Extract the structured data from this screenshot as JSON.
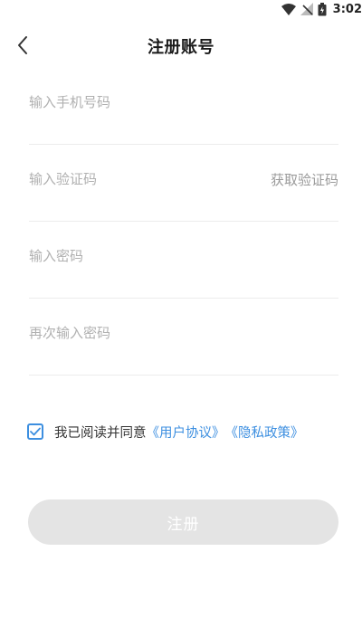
{
  "status_bar": {
    "time": "3:02",
    "icons": [
      "wifi-icon",
      "signal-icon",
      "battery-icon"
    ]
  },
  "header": {
    "back_icon": "chevron-left-icon",
    "title": "注册账号"
  },
  "form": {
    "phone": {
      "placeholder": "输入手机号码",
      "value": ""
    },
    "code": {
      "placeholder": "输入验证码",
      "value": "",
      "action_label": "获取验证码"
    },
    "password": {
      "placeholder": "输入密码",
      "value": ""
    },
    "confirm_password": {
      "placeholder": "再次输入密码",
      "value": ""
    }
  },
  "agreement": {
    "checked": true,
    "text": "我已阅读并同意",
    "user_agreement": "《用户协议》",
    "privacy_policy": "《隐私政策》"
  },
  "register_button": {
    "label": "注册",
    "enabled": false
  },
  "colors": {
    "accent": "#3d8fe0",
    "button_disabled_bg": "#e4e4e4",
    "placeholder": "#b0b0b0",
    "divider": "#ececec"
  }
}
